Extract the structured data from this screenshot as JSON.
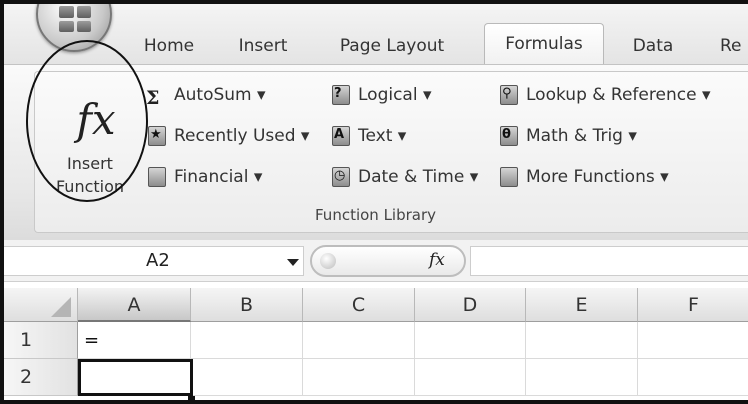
{
  "tabs": [
    {
      "label": "Home"
    },
    {
      "label": "Insert"
    },
    {
      "label": "Page Layout"
    },
    {
      "label": "Formulas",
      "active": true
    },
    {
      "label": "Data"
    },
    {
      "label": "Re"
    }
  ],
  "ribbon": {
    "insert_function": {
      "glyph": "fx",
      "label_line1": "Insert",
      "label_line2": "Function"
    },
    "commands": [
      {
        "label": "AutoSum",
        "icon": "sigma-icon",
        "has_dropdown": true
      },
      {
        "label": "Recently Used",
        "icon": "book-icon",
        "has_dropdown": true
      },
      {
        "label": "Financial",
        "icon": "book-icon",
        "has_dropdown": true
      },
      {
        "label": "Logical",
        "icon": "book-question-icon",
        "has_dropdown": true
      },
      {
        "label": "Text",
        "icon": "book-text-icon",
        "has_dropdown": true
      },
      {
        "label": "Date & Time",
        "icon": "book-clock-icon",
        "has_dropdown": true
      },
      {
        "label": "Lookup & Reference",
        "icon": "book-search-icon",
        "has_dropdown": true
      },
      {
        "label": "Math & Trig",
        "icon": "book-theta-icon",
        "has_dropdown": true
      },
      {
        "label": "More Functions",
        "icon": "book-more-icon",
        "has_dropdown": true
      }
    ],
    "group_label": "Function Library",
    "dropdown_glyph": "▾"
  },
  "formula_bar": {
    "name_box": "A2",
    "fx": "fx",
    "formula": ""
  },
  "sheet": {
    "columns": [
      "A",
      "B",
      "C",
      "D",
      "E",
      "F"
    ],
    "active_column": "A",
    "rows": [
      {
        "number": "1",
        "cells": [
          "=",
          "",
          "",
          "",
          "",
          ""
        ]
      },
      {
        "number": "2",
        "cells": [
          "",
          "",
          "",
          "",
          "",
          ""
        ]
      }
    ],
    "selected_cell": "A2"
  },
  "colors": {
    "accent_border": "#111111",
    "ribbon_bg": "#ececec"
  }
}
